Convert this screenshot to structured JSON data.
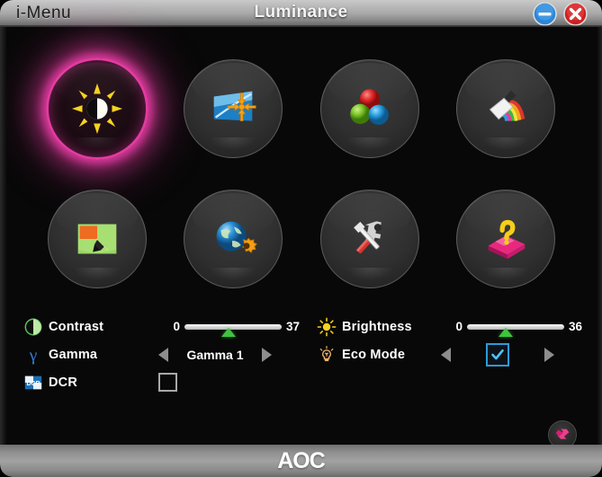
{
  "window": {
    "app_name": "i-Menu",
    "title": "Luminance",
    "minimize_label": "minimize",
    "close_label": "close"
  },
  "menu": {
    "items": [
      {
        "name": "luminance",
        "icon": "sun-contrast-icon",
        "selected": true
      },
      {
        "name": "image-setup",
        "icon": "screen-arrows-icon",
        "selected": false
      },
      {
        "name": "color-setup",
        "icon": "rgb-spheres-icon",
        "selected": false
      },
      {
        "name": "picture-boost",
        "icon": "rainbow-brush-icon",
        "selected": false
      },
      {
        "name": "osd-setup",
        "icon": "screen-pencil-icon",
        "selected": false
      },
      {
        "name": "language",
        "icon": "globe-gear-icon",
        "selected": false
      },
      {
        "name": "extra",
        "icon": "tools-icon",
        "selected": false
      },
      {
        "name": "help",
        "icon": "question-book-icon",
        "selected": false
      }
    ]
  },
  "controls": {
    "left": [
      {
        "key": "contrast",
        "label": "Contrast",
        "icon": "contrast-icon",
        "type": "slider",
        "min_label": "0",
        "max_label": "37",
        "value": 37,
        "min": 0,
        "max": 100,
        "thumb_percent": 45
      },
      {
        "key": "gamma",
        "label": "Gamma",
        "icon": "gamma-icon",
        "type": "spinner",
        "value": "Gamma 1",
        "prev_label": "previous",
        "next_label": "next"
      },
      {
        "key": "dcr",
        "label": "DCR",
        "icon": "dcr-icon",
        "type": "checkbox",
        "checked": false
      }
    ],
    "right": [
      {
        "key": "brightness",
        "label": "Brightness",
        "icon": "sun-icon",
        "type": "slider",
        "min_label": "0",
        "max_label": "36",
        "value": 36,
        "min": 0,
        "max": 100,
        "thumb_percent": 40
      },
      {
        "key": "eco-mode",
        "label": "Eco Mode",
        "icon": "bulb-icon",
        "type": "spinner-checkbox",
        "checked": true,
        "prev_label": "previous",
        "next_label": "next"
      }
    ]
  },
  "reset": {
    "name": "reset-button",
    "icon": "reset-arrows-icon"
  },
  "footer": {
    "brand": "AOC"
  },
  "colors": {
    "selection_glow": "#e23ba0",
    "slider_thumb": "#3fc43f",
    "checkbox_border": "#2d9bd6",
    "checkbox_tick": "#4fc3f7",
    "close_button": "#d02020",
    "minimize_button": "#2b86d8",
    "titlebar_text": "#f4f4f4"
  }
}
